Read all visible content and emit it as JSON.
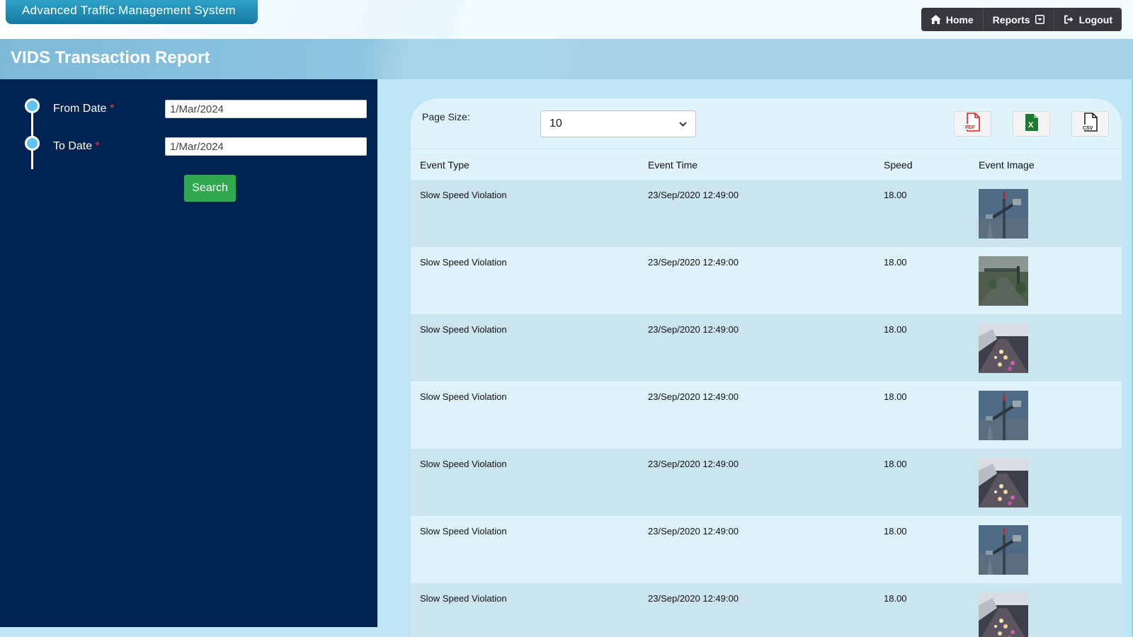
{
  "app": {
    "brand": "Advanced Traffic Management System",
    "nav": [
      {
        "label": "Home",
        "icon": "home-icon"
      },
      {
        "label": "Reports",
        "icon": "caret-square-down-icon"
      },
      {
        "label": "Logout",
        "icon": "logout-icon"
      }
    ]
  },
  "page": {
    "title": "VIDS Transaction Report"
  },
  "filters": {
    "from_label": "From Date",
    "to_label": "To Date",
    "required_mark": "*",
    "from_value": "1/Mar/2024",
    "to_value": "1/Mar/2024",
    "search_label": "Search"
  },
  "grid": {
    "page_size_label": "Page Size:",
    "page_size_value": "10",
    "exports": [
      {
        "name": "pdf-export",
        "icon": "pdf-file-icon",
        "color": "#e02020",
        "text": "PDF"
      },
      {
        "name": "excel-export",
        "icon": "excel-file-icon",
        "color": "#1e7a32",
        "text": "X"
      },
      {
        "name": "csv-export",
        "icon": "csv-file-icon",
        "color": "#222222",
        "text": "CSV"
      }
    ],
    "columns": [
      "Event Type",
      "Event Time",
      "Speed",
      "Event Image"
    ],
    "rows": [
      {
        "type": "Slow Speed Violation",
        "time": "23/Sep/2020 12:49:00",
        "speed": "18.00",
        "image": "pole-camera"
      },
      {
        "type": "Slow Speed Violation",
        "time": "23/Sep/2020 12:49:00",
        "speed": "18.00",
        "image": "highway-gantry"
      },
      {
        "type": "Slow Speed Violation",
        "time": "23/Sep/2020 12:49:00",
        "speed": "18.00",
        "image": "traffic-night"
      },
      {
        "type": "Slow Speed Violation",
        "time": "23/Sep/2020 12:49:00",
        "speed": "18.00",
        "image": "pole-camera"
      },
      {
        "type": "Slow Speed Violation",
        "time": "23/Sep/2020 12:49:00",
        "speed": "18.00",
        "image": "traffic-night"
      },
      {
        "type": "Slow Speed Violation",
        "time": "23/Sep/2020 12:49:00",
        "speed": "18.00",
        "image": "pole-camera"
      },
      {
        "type": "Slow Speed Violation",
        "time": "23/Sep/2020 12:49:00",
        "speed": "18.00",
        "image": "traffic-night"
      }
    ]
  },
  "colors": {
    "sidebar": "#002451",
    "search_button": "#2fa84f",
    "navbar": "#37383d",
    "brand": "#16789f"
  }
}
